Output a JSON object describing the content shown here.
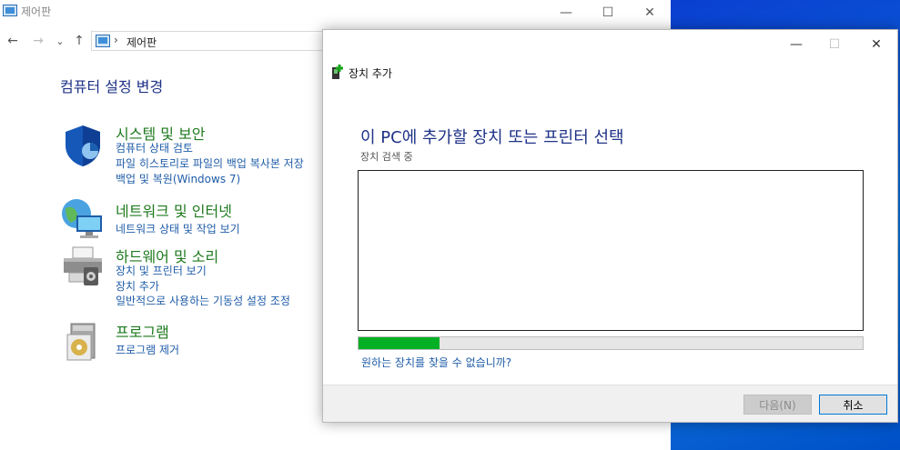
{
  "control_panel": {
    "title": "제어판",
    "heading": "컴퓨터 설정 변경",
    "nav": {
      "back": "←",
      "forward": "→",
      "recent": "⌄",
      "up": "↑",
      "address_sep": "›",
      "address": "제어판"
    },
    "window_buttons": {
      "minimize": "—",
      "maximize": "☐",
      "close": "✕"
    },
    "categories": [
      {
        "title": "시스템 및 보안",
        "icon": "shield-icon",
        "links": [
          "컴퓨터 상태 검토",
          "파일 히스토리로 파일의 백업 복사본 저장",
          "백업 및 복원(Windows 7)"
        ]
      },
      {
        "title": "네트워크 및 인터넷",
        "icon": "network-icon",
        "links": [
          "네트워크 상태 및 작업 보기"
        ]
      },
      {
        "title": "하드웨어 및 소리",
        "icon": "printer-icon",
        "links": [
          "장치 및 프린터 보기",
          "장치 추가",
          "일반적으로 사용하는 기동성 설정 조정"
        ]
      },
      {
        "title": "프로그램",
        "icon": "program-icon",
        "links": [
          "프로그램 제거"
        ]
      }
    ]
  },
  "dialog": {
    "header": "장치 추가",
    "main_title": "이 PC에 추가할 장치 또는 프린터 선택",
    "status": "장치 검색 중",
    "progress": 0.16,
    "help_link": "원하는 장치를 찾을 수 없습니까?",
    "next_button": "다음(N)",
    "cancel_button": "취소",
    "window_buttons": {
      "minimize": "—",
      "maximize": "☐",
      "close": "✕"
    }
  },
  "colors": {
    "category_title": "#1e7a1e",
    "link": "#1f5ca8",
    "heading": "#1e3287",
    "progress": "#06b025",
    "desktop": "#0a5ad6"
  }
}
